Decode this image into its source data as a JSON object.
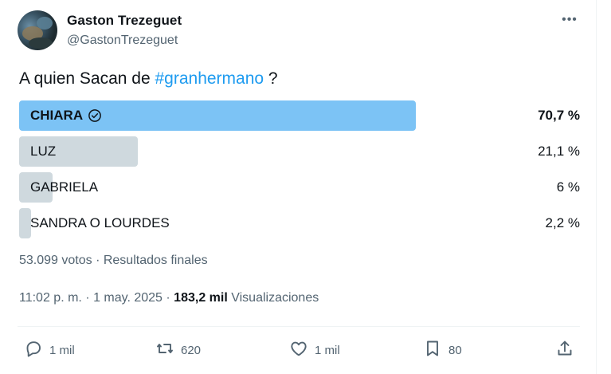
{
  "author": {
    "name": "Gaston Trezeguet",
    "handle": "@GastonTrezeguet",
    "avatar_icon": "profile-photo"
  },
  "tweet": {
    "text_before": "A quien Sacan de ",
    "hashtag": "#granhermano",
    "text_after": " ?"
  },
  "poll": {
    "options": [
      {
        "label": "CHIARA",
        "percent_text": "70,7 %",
        "percent": 70.7,
        "winner": true
      },
      {
        "label": "LUZ",
        "percent_text": "21,1 %",
        "percent": 21.1,
        "winner": false
      },
      {
        "label": "GABRIELA",
        "percent_text": "6 %",
        "percent": 6,
        "winner": false
      },
      {
        "label": "SANDRA O LOURDES",
        "percent_text": "2,2 %",
        "percent": 2.2,
        "winner": false
      }
    ],
    "footer": "53.099 votos · Resultados finales"
  },
  "meta": {
    "time": "11:02 p. m. · 1 may. 2025 · ",
    "views_count": "183,2 mil",
    "views_label": " Visualizaciones"
  },
  "actions": {
    "replies": "1 mil",
    "reposts": "620",
    "likes": "1 mil",
    "bookmarks": "80"
  },
  "colors": {
    "winner_bar": "#7cc3f5",
    "bar": "#cfd9de",
    "link": "#1d9bf0",
    "muted": "#536471"
  }
}
